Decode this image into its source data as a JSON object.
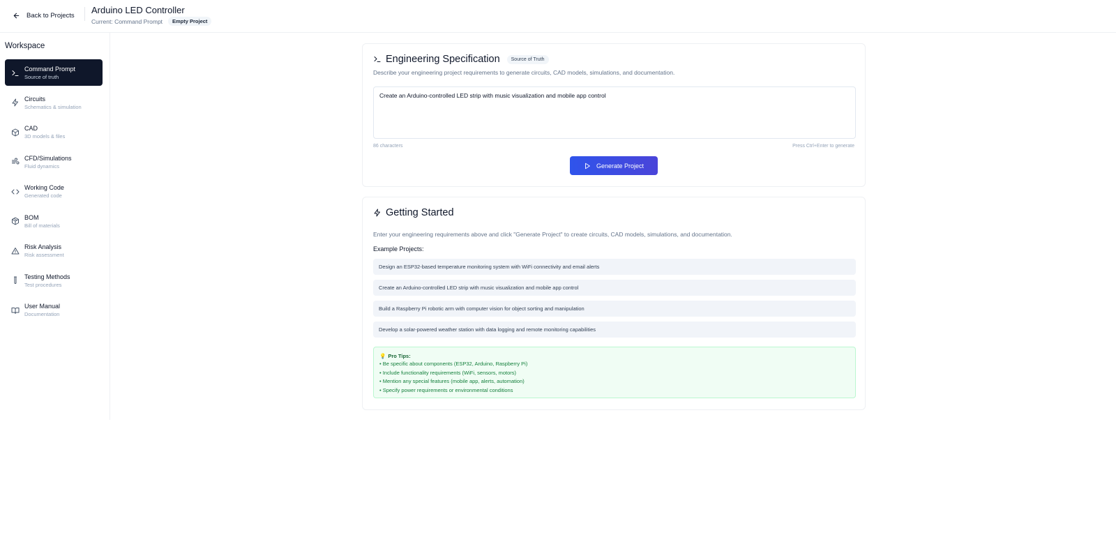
{
  "header": {
    "back_label": "Back to Projects",
    "project_title": "Arduino LED Controller",
    "current_label": "Current: Command Prompt",
    "status_badge": "Empty Project"
  },
  "sidebar": {
    "title": "Workspace",
    "items": [
      {
        "label": "Command Prompt",
        "sub": "Source of truth",
        "icon": "terminal-icon",
        "active": true
      },
      {
        "label": "Circuits",
        "sub": "Schematics & simulation",
        "icon": "zap-icon"
      },
      {
        "label": "CAD",
        "sub": "3D models & files",
        "icon": "box-icon"
      },
      {
        "label": "CFD/Simulations",
        "sub": "Fluid dynamics",
        "icon": "wind-icon"
      },
      {
        "label": "Working Code",
        "sub": "Generated code",
        "icon": "code-icon"
      },
      {
        "label": "BOM",
        "sub": "Bill of materials",
        "icon": "package-icon"
      },
      {
        "label": "Risk Analysis",
        "sub": "Risk assessment",
        "icon": "warning-icon"
      },
      {
        "label": "Testing Methods",
        "sub": "Test procedures",
        "icon": "test-tube-icon"
      },
      {
        "label": "User Manual",
        "sub": "Documentation",
        "icon": "book-icon"
      }
    ]
  },
  "spec": {
    "title": "Engineering Specification",
    "badge": "Source of Truth",
    "description": "Describe your engineering project requirements to generate circuits, CAD models, simulations, and documentation.",
    "input_value": "Create an Arduino-controlled LED strip with music visualization and mobile app control",
    "char_count": "86 characters",
    "hint": "Press Ctrl+Enter to generate",
    "generate_label": "Generate Project"
  },
  "getting_started": {
    "title": "Getting Started",
    "description": "Enter your engineering requirements above and click \"Generate Project\" to create circuits, CAD models, simulations, and documentation.",
    "examples_title": "Example Projects:",
    "examples": [
      "Design an ESP32-based temperature monitoring system with WiFi connectivity and email alerts",
      "Create an Arduino-controlled LED strip with music visualization and mobile app control",
      "Build a Raspberry Pi robotic arm with computer vision for object sorting and manipulation",
      "Develop a solar-powered weather station with data logging and remote monitoring capabilities"
    ],
    "tips_icon": "💡",
    "tips_title": "Pro Tips:",
    "tips": [
      "• Be specific about components (ESP32, Arduino, Raspberry Pi)",
      "• Include functionality requirements (WiFi, sensors, motors)",
      "• Mention any special features (mobile app, alerts, automation)",
      "• Specify power requirements or environmental conditions"
    ]
  }
}
